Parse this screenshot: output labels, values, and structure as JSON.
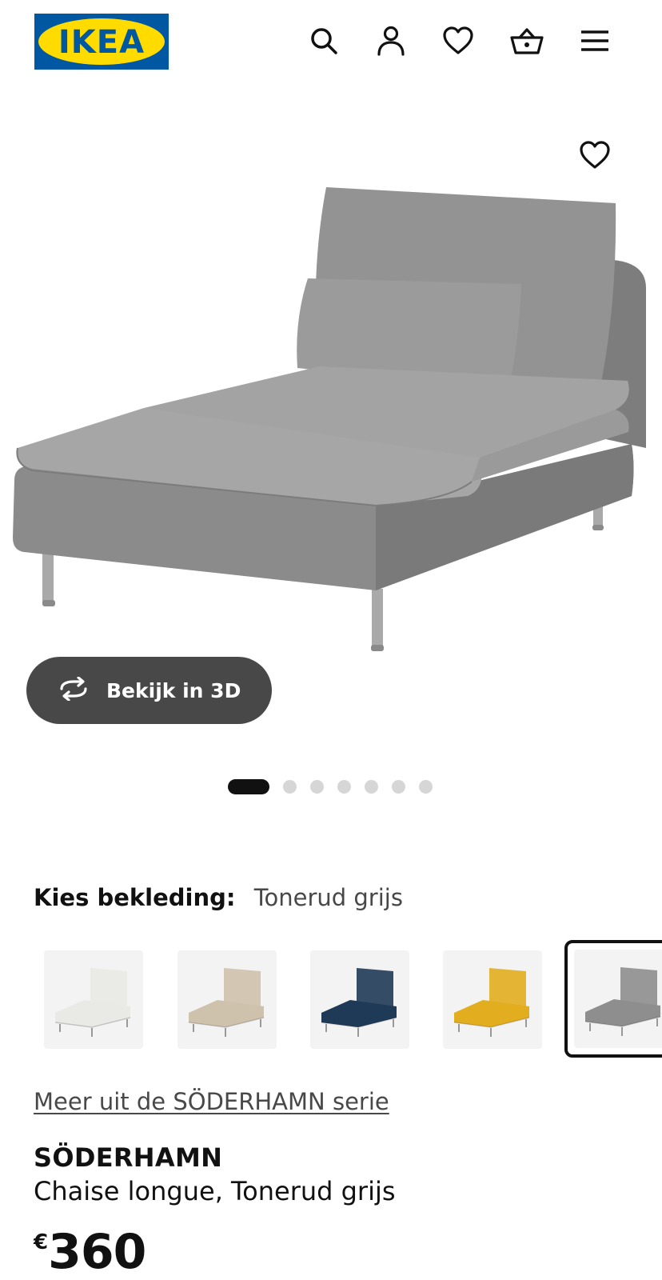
{
  "header": {
    "logo_text": "IKEA",
    "icons": [
      "search-icon",
      "account-icon",
      "wishlist-icon",
      "cart-icon",
      "menu-icon"
    ]
  },
  "gallery": {
    "view3d_label": "Bekijk in 3D",
    "dot_count": 7,
    "active_dot": 1
  },
  "cover": {
    "label": "Kies bekleding:",
    "value": "Tonerud grijs",
    "swatches": [
      {
        "color": "#e9e9e6"
      },
      {
        "color": "#cfc2ad"
      },
      {
        "color": "#1f3a56"
      },
      {
        "color": "#e2ad1f"
      },
      {
        "color": "#8e8e8e",
        "selected": true
      }
    ]
  },
  "series_link": "Meer uit de SÖDERHAMN serie",
  "product": {
    "name": "SÖDERHAMN",
    "description": "Chaise longue, Tonerud grijs",
    "currency": "€",
    "price": "360"
  },
  "colors": {
    "ikea_blue": "#0058a3",
    "ikea_yellow": "#ffdb00",
    "pill_dark": "#484848",
    "sofa_grey": "#8c8c8c"
  }
}
